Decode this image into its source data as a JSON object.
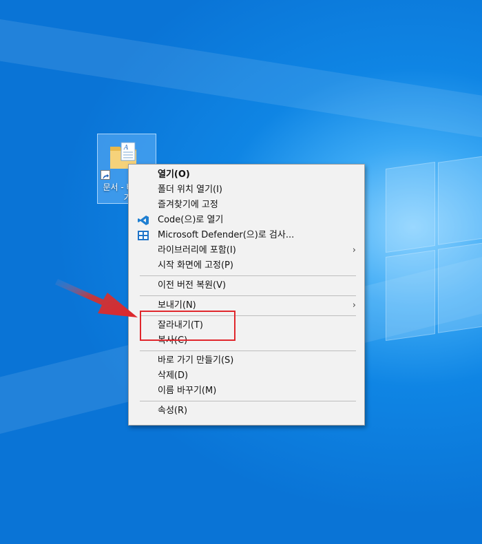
{
  "desktop": {
    "shortcut": {
      "icon": "folder-documents-shortcut-icon",
      "label": "문서 - 바로 가기"
    }
  },
  "context_menu": {
    "groups": [
      [
        {
          "label": "열기(O)",
          "bold": true
        },
        {
          "label": "폴더 위치 열기(I)"
        },
        {
          "label": "즐겨찾기에 고정"
        },
        {
          "label": "Code(으)로 열기",
          "icon": "vscode-icon"
        },
        {
          "label": "Microsoft Defender(으)로 검사...",
          "icon": "defender-icon"
        },
        {
          "label": "라이브러리에 포함(I)",
          "submenu": true
        },
        {
          "label": "시작 화면에 고정(P)"
        }
      ],
      [
        {
          "label": "이전 버전 복원(V)"
        }
      ],
      [
        {
          "label": "보내기(N)",
          "submenu": true
        }
      ],
      [
        {
          "label": "잘라내기(T)",
          "highlighted": true
        },
        {
          "label": "복사(C)"
        }
      ],
      [
        {
          "label": "바로 가기 만들기(S)"
        },
        {
          "label": "삭제(D)"
        },
        {
          "label": "이름 바꾸기(M)"
        }
      ],
      [
        {
          "label": "속성(R)"
        }
      ]
    ],
    "submenu_arrow": "›"
  },
  "annotation": {
    "highlight_color": "#e0262b",
    "arrow_color": "#d9232a"
  }
}
